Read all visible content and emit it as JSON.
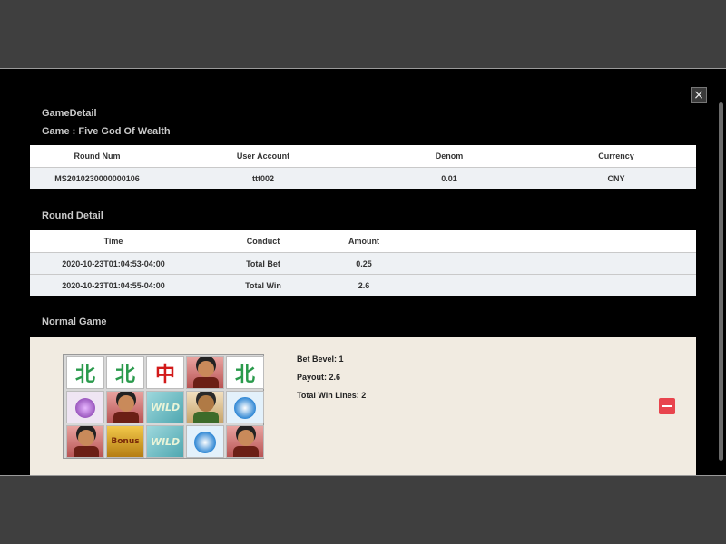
{
  "header": {
    "title": "GameDetail",
    "game_label": "Game : Five God Of Wealth",
    "close_glyph": "×"
  },
  "round_table": {
    "columns": [
      "Round Num",
      "User Account",
      "Denom",
      "Currency"
    ],
    "row": [
      "MS2010230000000106",
      "ttt002",
      "0.01",
      "CNY"
    ]
  },
  "round_detail": {
    "title": "Round Detail",
    "columns": [
      "Time",
      "Conduct",
      "Amount"
    ],
    "rows": [
      [
        "2020-10-23T01:04:53-04:00",
        "Total Bet",
        "0.25"
      ],
      [
        "2020-10-23T01:04:55-04:00",
        "Total Win",
        "2.6"
      ]
    ]
  },
  "normal_game": {
    "title": "Normal Game",
    "bet_level": "Bet Bevel: 1",
    "payout": "Payout: 2.6",
    "total_win_lines": "Total Win Lines: 2",
    "symbol_text": {
      "north": "北",
      "zhong": "中",
      "wild": "WILD",
      "gold": "Bonus"
    },
    "reels": [
      [
        "north",
        "north",
        "zhong",
        "god",
        "north"
      ],
      [
        "purple",
        "god",
        "wild",
        "god2",
        "blue"
      ],
      [
        "god",
        "gold",
        "wild",
        "blue",
        "god"
      ]
    ]
  },
  "colors": {
    "modal_bg": "#000000",
    "panel_bg": "#f1ebe1",
    "row_bg": "#eef1f4",
    "collapse_button": "#e8444d"
  }
}
